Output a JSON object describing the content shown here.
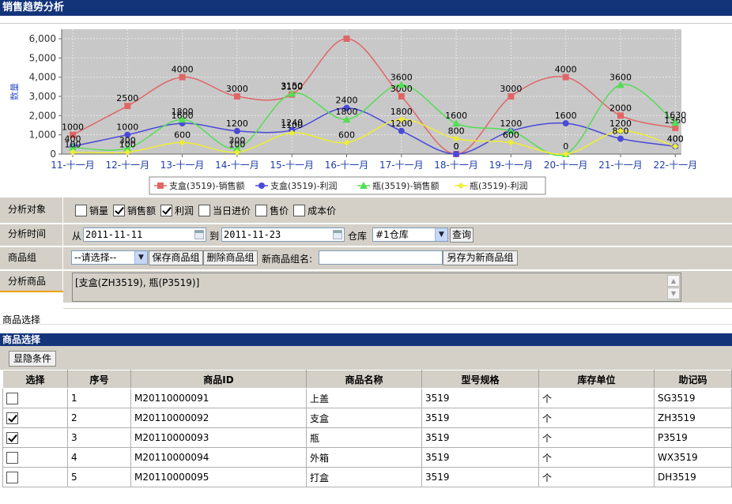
{
  "page": {
    "title": "销售趋势分析"
  },
  "chart_data": {
    "type": "line",
    "title": "",
    "xlabel": "",
    "ylabel": "数量",
    "categories": [
      "11-十一月",
      "12-十一月",
      "13-十一月",
      "14-十一月",
      "15-十一月",
      "16-十一月",
      "17-十一月",
      "18-十一月",
      "19-十一月",
      "20-十一月",
      "21-十一月",
      "22-十一月"
    ],
    "ylim": [
      0,
      6000
    ],
    "yticks": [
      "0",
      "1,000",
      "2,000",
      "3,000",
      "4,000",
      "5,000",
      "6,000"
    ],
    "grid": true,
    "legend_position": "bottom",
    "series": [
      {
        "name": "支盒(3519)-销售额",
        "color": "#e06666",
        "marker": "square",
        "values": [
          1000,
          2500,
          4000,
          3000,
          3100,
          6000,
          3000,
          0,
          3000,
          4000,
          2000,
          1360
        ],
        "labels": [
          "1000",
          "2500",
          "4000",
          "3000",
          "3100",
          "",
          "3000",
          "0",
          "3000",
          "4000",
          "2000",
          "1360"
        ]
      },
      {
        "name": "支盒(3519)-利润",
        "color": "#4a4ad8",
        "marker": "circle",
        "values": [
          400,
          1000,
          1600,
          1200,
          1240,
          2400,
          1200,
          0,
          1200,
          1600,
          800,
          400
        ],
        "labels": [
          "400",
          "1000",
          "1600",
          "1200",
          "1240",
          "2400",
          "1200",
          "0",
          "1200",
          "1600",
          "800",
          "400"
        ]
      },
      {
        "name": "瓶(3519)-销售额",
        "color": "#55dd55",
        "marker": "triangle",
        "values": [
          350,
          300,
          1800,
          300,
          3150,
          1800,
          3600,
          1600,
          1200,
          0,
          3600,
          1630
        ],
        "labels": [
          "",
          "300",
          "1800",
          "300",
          "3150",
          "1800",
          "3600",
          "1600",
          "",
          "0",
          "3600",
          "1630"
        ]
      },
      {
        "name": "瓶(3519)-利润",
        "color": "#eeee33",
        "marker": "diamond",
        "values": [
          100,
          100,
          600,
          100,
          1100,
          600,
          1800,
          800,
          600,
          0,
          1200,
          400
        ],
        "labels": [
          "100",
          "100",
          "600",
          "100",
          "1100",
          "600",
          "1800",
          "800",
          "600",
          "",
          "1200",
          "400"
        ]
      }
    ]
  },
  "form": {
    "target_label": "分析对象",
    "checkboxes": [
      {
        "label": "销量",
        "checked": false
      },
      {
        "label": "销售额",
        "checked": true
      },
      {
        "label": "利润",
        "checked": true
      },
      {
        "label": "当日进价",
        "checked": false
      },
      {
        "label": "售价",
        "checked": false
      },
      {
        "label": "成本价",
        "checked": false
      }
    ],
    "time_label": "分析时间",
    "from_label": "从",
    "from_value": "2011-11-11",
    "to_label": "到",
    "to_value": "2011-11-23",
    "warehouse_label": "仓库",
    "warehouse_value": "#1仓库",
    "query_button": "查询",
    "group_label": "商品组",
    "group_select": "--请选择--",
    "save_group_button": "保存商品组",
    "delete_group_button": "删除商品组",
    "new_group_label": "新商品组名:",
    "new_group_value": "",
    "save_as_button": "另存为新商品组",
    "products_label": "分析商品",
    "products_value": "[支盒(ZH3519), 瓶(P3519)]"
  },
  "product_select_tab": "商品选择",
  "product_section": {
    "title": "商品选择",
    "toggle_button": "显隐条件",
    "columns": [
      "选择",
      "序号",
      "商品ID",
      "商品名称",
      "型号规格",
      "库存单位",
      "助记码"
    ],
    "rows": [
      {
        "checked": false,
        "no": "1",
        "id": "M20110000091",
        "name": "上盖",
        "spec": "3519",
        "unit": "个",
        "code": "SG3519"
      },
      {
        "checked": true,
        "no": "2",
        "id": "M20110000092",
        "name": "支盒",
        "spec": "3519",
        "unit": "个",
        "code": "ZH3519"
      },
      {
        "checked": true,
        "no": "3",
        "id": "M20110000093",
        "name": "瓶",
        "spec": "3519",
        "unit": "个",
        "code": "P3519"
      },
      {
        "checked": false,
        "no": "4",
        "id": "M20110000094",
        "name": "外箱",
        "spec": "3519",
        "unit": "个",
        "code": "WX3519"
      },
      {
        "checked": false,
        "no": "5",
        "id": "M20110000095",
        "name": "打盒",
        "spec": "3519",
        "unit": "个",
        "code": "DH3519"
      }
    ]
  }
}
